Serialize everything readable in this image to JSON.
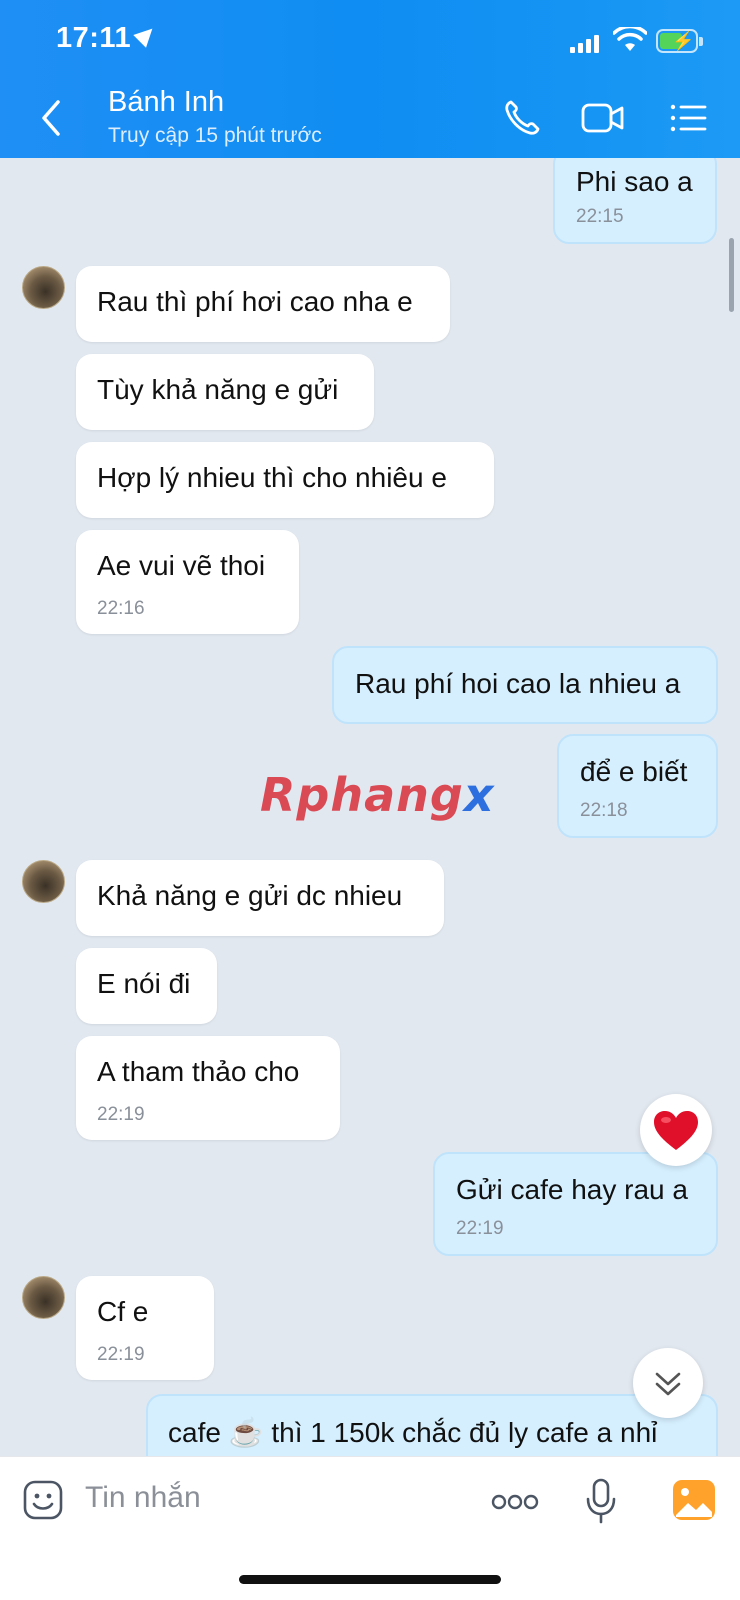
{
  "status_bar": {
    "time": "17:11"
  },
  "header": {
    "contact_name": "Bánh Inh",
    "contact_status": "Truy cập 15 phút trước",
    "icons": [
      "back-chevron-icon",
      "phone-icon",
      "video-call-icon",
      "menu-list-icon"
    ]
  },
  "messages": [
    {
      "side": "out",
      "text": "Phi sao a",
      "time": "22:15"
    },
    {
      "side": "in",
      "text": "Rau thì phí hơi cao nha e"
    },
    {
      "side": "in",
      "text": "Tùy khả năng e gửi"
    },
    {
      "side": "in",
      "text": "Hợp lý nhieu thì cho nhiêu e"
    },
    {
      "side": "in",
      "text": "Ae vui vẽ thoi",
      "time": "22:16"
    },
    {
      "side": "out",
      "text": "Rau phí hoi cao la nhieu a"
    },
    {
      "side": "out",
      "text": "để e biết",
      "time": "22:18"
    },
    {
      "side": "in",
      "text": "Khả năng e gửi dc nhieu"
    },
    {
      "side": "in",
      "text": "E nói đi"
    },
    {
      "side": "in",
      "text": "A tham thảo cho",
      "time": "22:19"
    },
    {
      "side": "out",
      "text": "Gửi cafe hay rau a",
      "time": "22:19",
      "reaction": "heart"
    },
    {
      "side": "in",
      "text": "Cf e",
      "time": "22:19"
    },
    {
      "side": "out",
      "text": "cafe ☕ thì 1 150k chắc đủ ly cafe a nhỉ"
    }
  ],
  "watermark": {
    "main": "Rphang",
    "accent": "x"
  },
  "input_bar": {
    "placeholder": "Tin nhắn",
    "icons": [
      "sticker-icon",
      "more-options-icon",
      "microphone-icon",
      "image-gallery-icon"
    ]
  },
  "colors": {
    "header_blue": "#1f8ff5",
    "chat_background": "#e2e8f0",
    "outgoing_bubble": "#d5efff",
    "incoming_bubble": "#ffffff",
    "reaction_heart": "#e0102a"
  }
}
